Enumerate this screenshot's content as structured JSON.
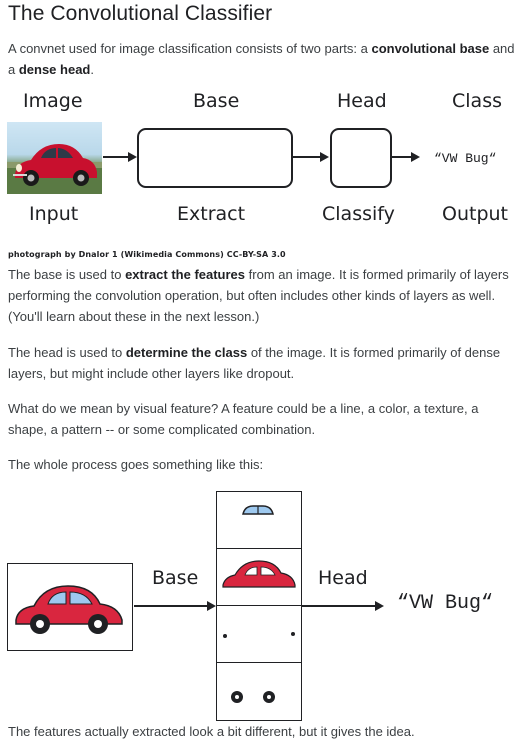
{
  "title": "The Convolutional Classifier",
  "intro": {
    "text_before": "A convnet used for image classification consists of two parts: a ",
    "bold1": "convolutional base",
    "text_mid": " and a ",
    "bold2": "dense head",
    "text_end": "."
  },
  "diagram1": {
    "top_labels": {
      "image": "Image",
      "base": "Base",
      "head": "Head",
      "class": "Class"
    },
    "bottom_labels": {
      "input": "Input",
      "extract": "Extract",
      "classify": "Classify",
      "output": "Output"
    },
    "output_text": "“VW Bug“"
  },
  "credit": "photograph by Dnalor 1 (Wikimedia Commons) CC-BY-SA 3.0",
  "para_base": {
    "text_before": "The base is used to ",
    "bold": "extract the features",
    "text_after": " from an image. It is formed primarily of layers performing the convolution operation, but often includes other kinds of layers as well. (You'll learn about these in the next lesson.)"
  },
  "para_head": {
    "text_before": "The head is used to ",
    "bold": "determine the class",
    "text_after": " of the image. It is formed primarily of dense layers, but might include other layers like dropout."
  },
  "para_feature": "What do we mean by visual feature? A feature could be a line, a color, a texture, a shape, a pattern -- or some complicated combination.",
  "para_process": "The whole process goes something like this:",
  "diagram2": {
    "base_label": "Base",
    "head_label": "Head",
    "output_text": "“VW Bug“"
  },
  "para_final": "The features actually extracted look a bit different, but it gives the idea.",
  "colors": {
    "car_red": "#d9263f",
    "window_blue": "#9ec9ef",
    "text": "#3c4043",
    "heading": "#202124"
  }
}
